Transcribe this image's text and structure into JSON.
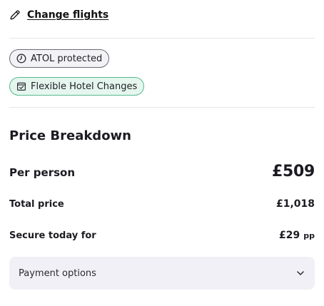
{
  "actions": {
    "change_flights_label": "Change flights"
  },
  "badges": {
    "atol": {
      "label": "ATOL protected",
      "icon": "atol-clock-icon"
    },
    "flexible_hotel": {
      "label": "Flexible Hotel Changes",
      "icon": "calendar-check-icon"
    }
  },
  "price_breakdown": {
    "title": "Price Breakdown",
    "per_person": {
      "label": "Per person",
      "value": "£509"
    },
    "total": {
      "label": "Total price",
      "value": "£1,018"
    },
    "secure_today": {
      "label": "Secure today for",
      "value": "£29",
      "suffix": "pp"
    }
  },
  "payment_options": {
    "label": "Payment options",
    "icon": "chevron-down-icon"
  },
  "colors": {
    "flexible_badge_bg": "#e5f6ee",
    "flexible_badge_border": "#58b890",
    "atol_badge_bg": "#f3f3f6",
    "payment_bg": "#f1f0f6"
  }
}
